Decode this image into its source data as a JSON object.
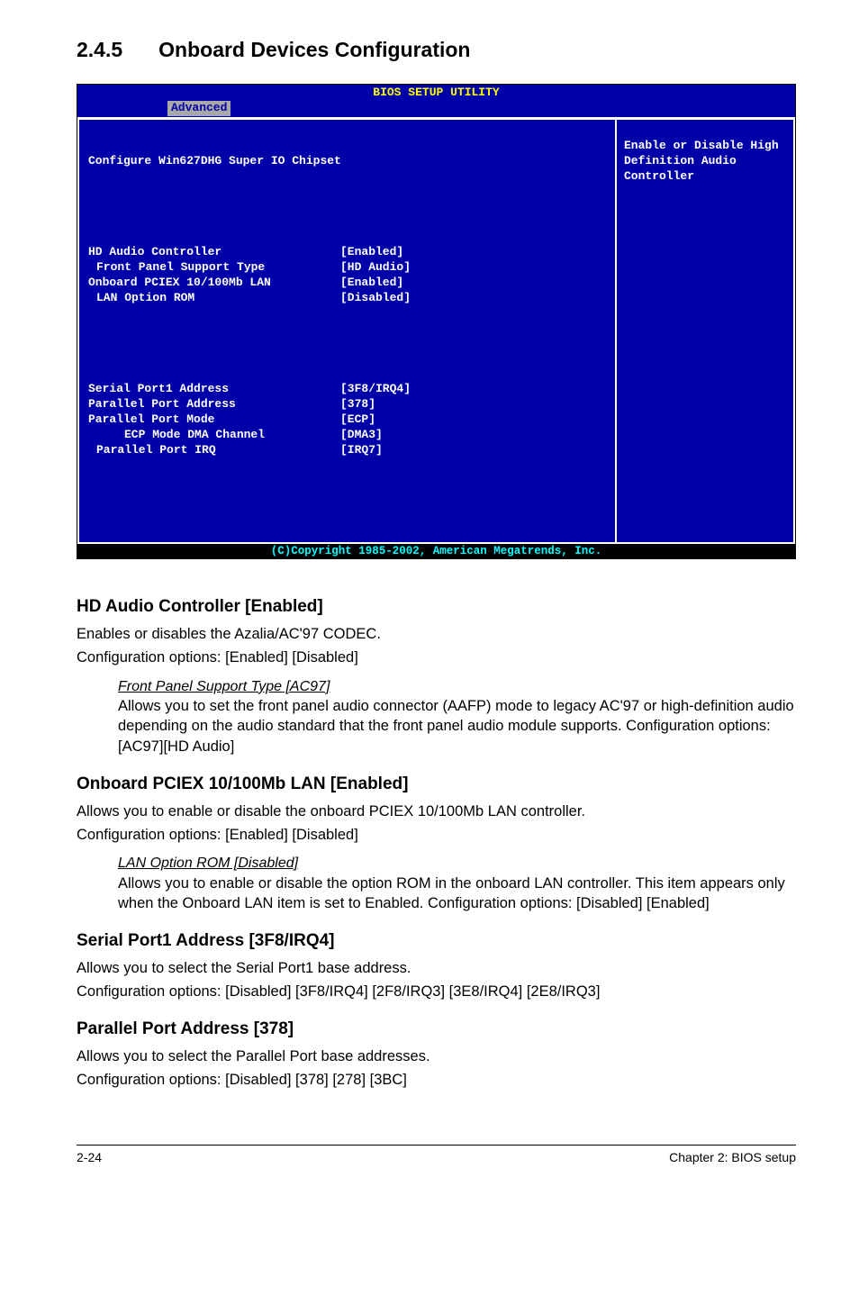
{
  "section": {
    "number": "2.4.5",
    "title": "Onboard Devices Configuration"
  },
  "bios": {
    "header_title": "BIOS SETUP UTILITY",
    "tab": "Advanced",
    "left_title": "Configure Win627DHG Super IO Chipset",
    "group1": [
      {
        "label": "HD Audio Controller",
        "val": "[Enabled]",
        "indent": 0
      },
      {
        "label": "Front Panel Support Type",
        "val": "[HD Audio]",
        "indent": 1
      },
      {
        "label": "Onboard PCIEX 10/100Mb LAN",
        "val": "[Enabled]",
        "indent": 0
      },
      {
        "label": "LAN Option ROM",
        "val": "[Disabled]",
        "indent": 1
      }
    ],
    "group2": [
      {
        "label": "Serial Port1 Address",
        "val": "[3F8/IRQ4]",
        "indent": 0
      },
      {
        "label": "Parallel Port Address",
        "val": "[378]",
        "indent": 0
      },
      {
        "label": "Parallel Port Mode",
        "val": "[ECP]",
        "indent": 0
      },
      {
        "label": "ECP Mode DMA Channel",
        "val": "[DMA3]",
        "indent": 2
      },
      {
        "label": "Parallel Port IRQ",
        "val": "[IRQ7]",
        "indent": 1
      }
    ],
    "help": "Enable or Disable High Definition Audio Controller",
    "footer": "(C)Copyright 1985-2002, American Megatrends, Inc."
  },
  "content": {
    "hd_audio": {
      "heading": "HD Audio Controller [Enabled]",
      "p1": "Enables or disables the Azalia/AC'97 CODEC.",
      "p2": "Configuration options: [Enabled] [Disabled]",
      "sub_ital": "Front Panel Support Type [AC97]",
      "sub_body": "Allows you to set the front panel audio connector (AAFP) mode to legacy AC'97 or high-definition audio depending on the audio standard that the front panel audio module supports. Configuration options: [AC97][HD Audio]"
    },
    "pciex": {
      "heading": "Onboard PCIEX 10/100Mb LAN [Enabled]",
      "p1": "Allows you to enable or disable the onboard PCIEX 10/100Mb LAN controller.",
      "p2": "Configuration options: [Enabled] [Disabled]",
      "sub_ital": "LAN Option ROM [Disabled]",
      "sub_body": "Allows you to enable or disable the option ROM in the onboard LAN controller. This item appears only when the Onboard LAN item is set to Enabled. Configuration options: [Disabled] [Enabled]"
    },
    "serial": {
      "heading": "Serial Port1 Address [3F8/IRQ4]",
      "p1": "Allows you to select the Serial Port1 base address.",
      "p2": "Configuration options: [Disabled] [3F8/IRQ4] [2F8/IRQ3] [3E8/IRQ4] [2E8/IRQ3]"
    },
    "parallel": {
      "heading": "Parallel Port Address [378]",
      "p1": "Allows you to select the Parallel Port base addresses.",
      "p2": "Configuration options: [Disabled] [378] [278] [3BC]"
    }
  },
  "footer": {
    "left": "2-24",
    "right": "Chapter 2: BIOS setup"
  }
}
